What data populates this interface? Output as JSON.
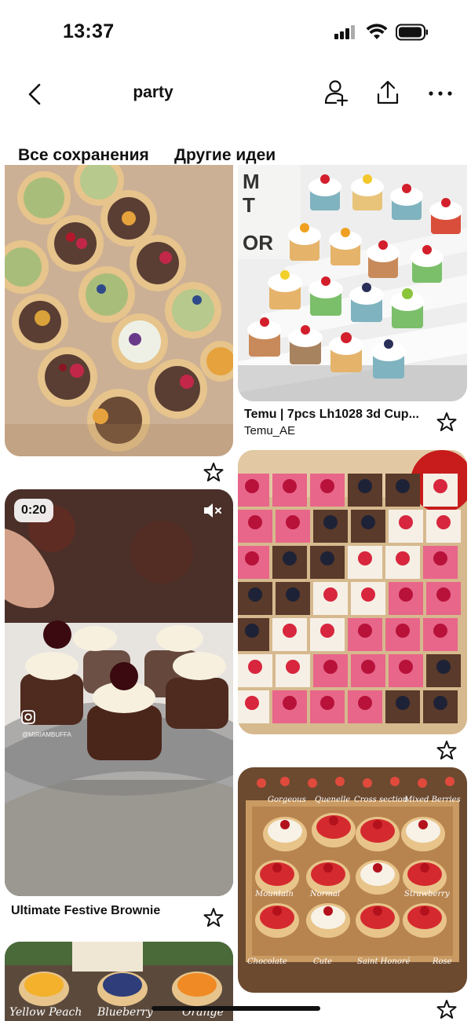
{
  "status": {
    "time": "13:37"
  },
  "nav": {
    "title": "party",
    "icons": [
      "back-chevron-icon",
      "add-person-icon",
      "share-icon",
      "more-icon"
    ]
  },
  "tabs": [
    {
      "label": "Все сохранения",
      "active": true
    },
    {
      "label": "Другие идеи",
      "active": false
    }
  ],
  "pins": {
    "tartlets": {
      "alt": "",
      "star": "star-icon"
    },
    "cupcakes": {
      "title": "Temu | 7pcs Lh1028 3d Cup...",
      "subtitle": "Temu_AE"
    },
    "brownie": {
      "duration": "0:20",
      "title": "Ultimate Festive Brownie",
      "watermark": "@MIRIAMBUFFA"
    },
    "squares": {},
    "fruit_tarts": {
      "labels": [
        "Gorgeous",
        "Quenelle",
        "Cross section",
        "Mixed Berries",
        "Mountain",
        "Normal",
        "Strawberry",
        "Chocolate",
        "Cute",
        "Saint Honoré",
        "Rose"
      ]
    },
    "bottom": {
      "labels": [
        "Yellow Peach",
        "Blueberry",
        "Orange"
      ]
    }
  },
  "colors": {
    "accent": "#111111",
    "background": "#ffffff"
  }
}
